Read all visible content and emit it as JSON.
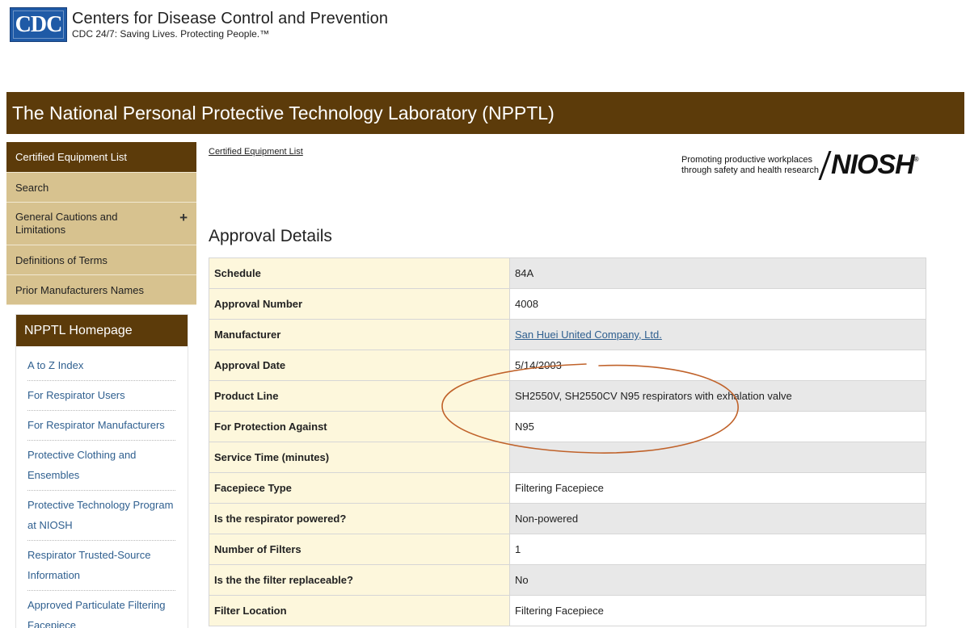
{
  "header": {
    "logo_text": "CDC",
    "title": "Centers for Disease Control and Prevention",
    "tagline": "CDC 24/7: Saving Lives. Protecting People.™"
  },
  "banner": {
    "title": "The National Personal Protective Technology Laboratory (NPPTL)"
  },
  "leftnav": {
    "items": [
      {
        "label": "Certified Equipment List"
      },
      {
        "label": "Search"
      },
      {
        "label": "General Cautions and Limitations",
        "expand": "+"
      },
      {
        "label": "Definitions of Terms"
      },
      {
        "label": "Prior Manufacturers Names"
      }
    ]
  },
  "homepage": {
    "title": "NPPTL Homepage",
    "links": [
      "A to Z Index",
      "For Respirator Users",
      "For Respirator Manufacturers",
      "Protective Clothing and Ensembles",
      "Protective Technology Program at NIOSH",
      "Respirator Trusted-Source Information",
      "Approved Particulate Filtering Facepiece"
    ]
  },
  "breadcrumb": "Certified Equipment List",
  "niosh": {
    "tagline_line1": "Promoting productive workplaces",
    "tagline_line2": "through safety and health research",
    "logo": "NIOSH",
    "reg": "®"
  },
  "main": {
    "title": "Approval Details",
    "rows": [
      {
        "label": "Schedule",
        "value": "84A"
      },
      {
        "label": "Approval Number",
        "value": "4008"
      },
      {
        "label": "Manufacturer",
        "value": "San Huei United Company, Ltd."
      },
      {
        "label": "Approval Date",
        "value": "5/14/2003"
      },
      {
        "label": "Product Line",
        "value": "SH2550V, SH2550CV N95 respirators with exhalation valve"
      },
      {
        "label": "For Protection Against",
        "value": "N95"
      },
      {
        "label": "Service Time (minutes)",
        "value": ""
      },
      {
        "label": "Facepiece Type",
        "value": "Filtering Facepiece"
      },
      {
        "label": "Is the respirator powered?",
        "value": "Non-powered"
      },
      {
        "label": "Number of Filters",
        "value": "1"
      },
      {
        "label": "Is the the filter replaceable?",
        "value": "No"
      },
      {
        "label": "Filter Location",
        "value": "Filtering Facepiece"
      }
    ]
  },
  "colors": {
    "brand_brown": "#5c3b0a",
    "nav_tan": "#d7c28f",
    "label_cream": "#fdf7dc",
    "link_blue": "#2f5f8f",
    "annotation": "#c0622a"
  }
}
